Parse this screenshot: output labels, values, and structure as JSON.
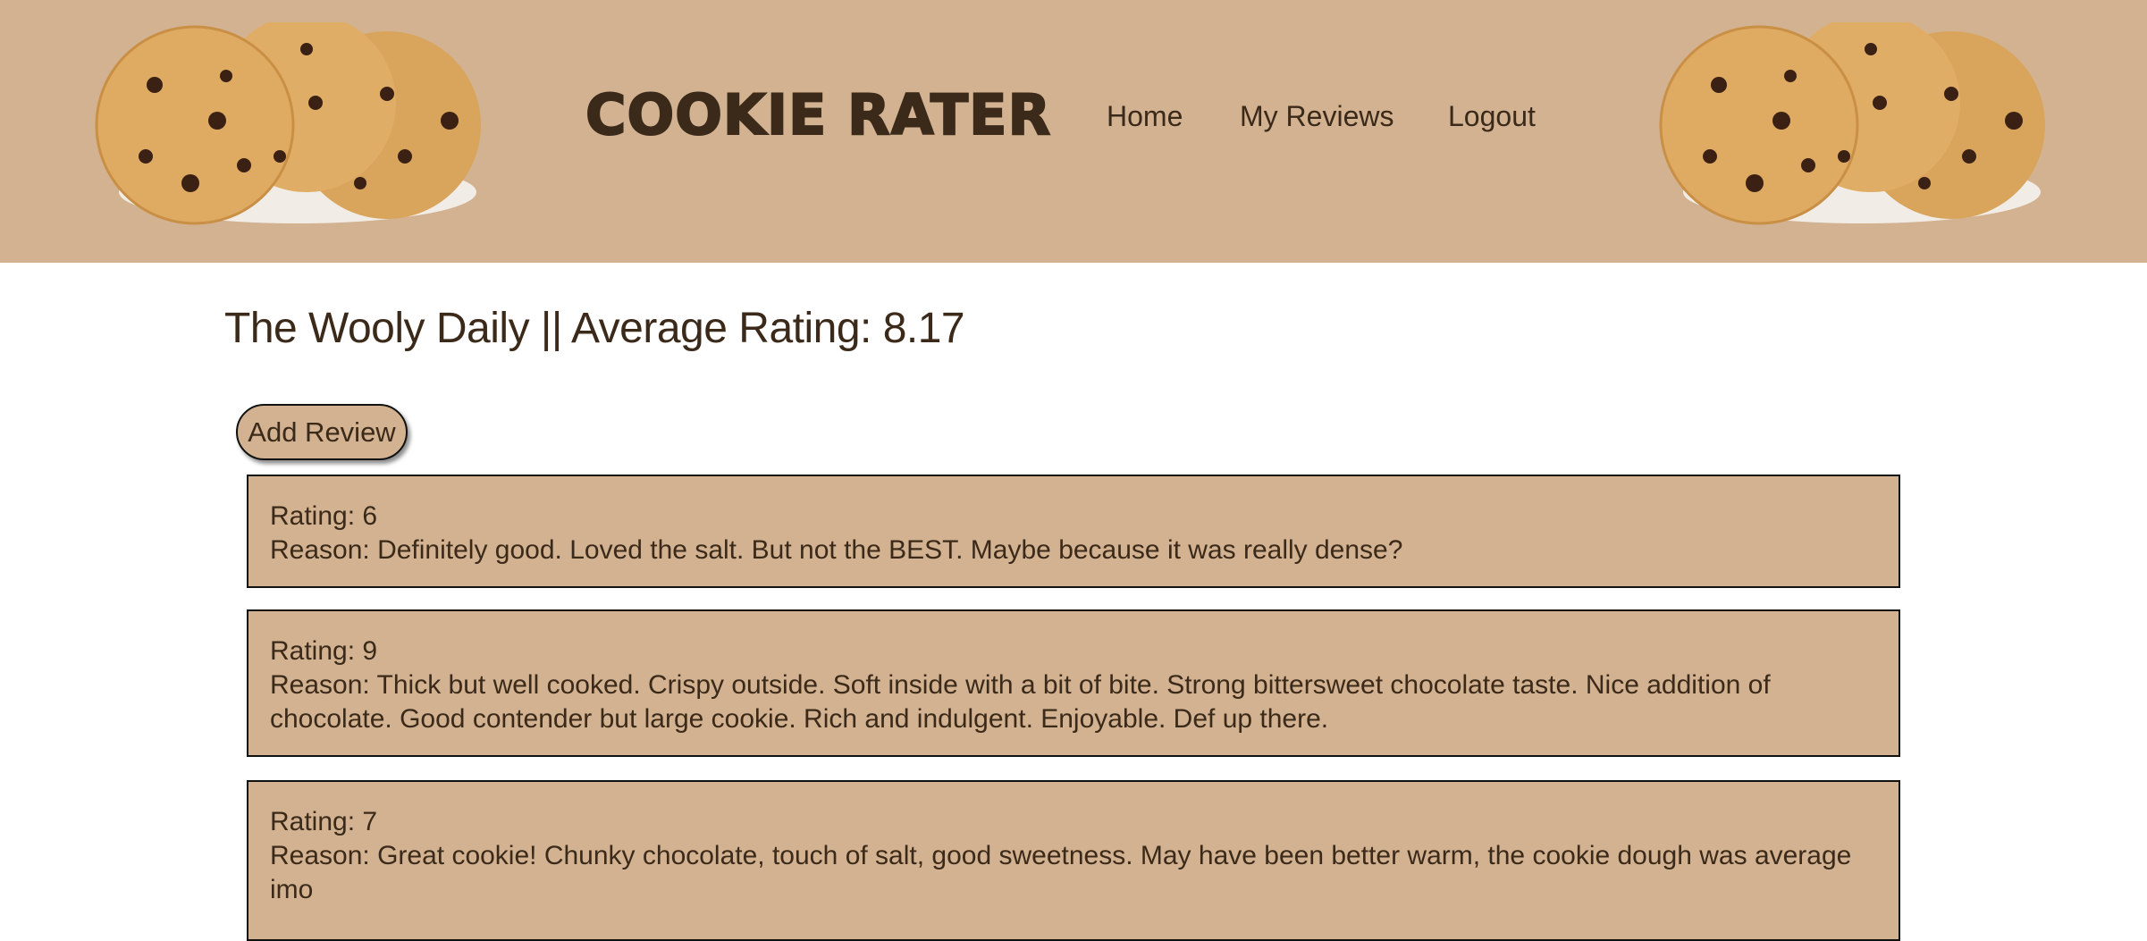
{
  "header": {
    "brand": "COOKIE RATER",
    "nav": [
      "Home",
      "My Reviews",
      "Logout"
    ]
  },
  "page": {
    "title": "The Wooly Daily || Average Rating: 8.17",
    "add_review_label": "Add Review"
  },
  "reviews": [
    {
      "rating": "Rating: 6",
      "reason": "Reason: Definitely good. Loved the salt. But not the BEST. Maybe because it was really dense?"
    },
    {
      "rating": "Rating: 9",
      "reason": "Reason: Thick but well cooked. Crispy outside. Soft inside with a bit of bite. Strong bittersweet chocolate taste. Nice addition of chocolate. Good contender but large cookie. Rich and indulgent. Enjoyable. Def up there."
    },
    {
      "rating": "Rating: 7",
      "reason": "Reason: Great cookie! Chunky chocolate, touch of salt, good sweetness. May have been better warm, the cookie dough was average imo"
    }
  ],
  "colors": {
    "accent": "#d2b290",
    "text": "#3b2a1a"
  }
}
